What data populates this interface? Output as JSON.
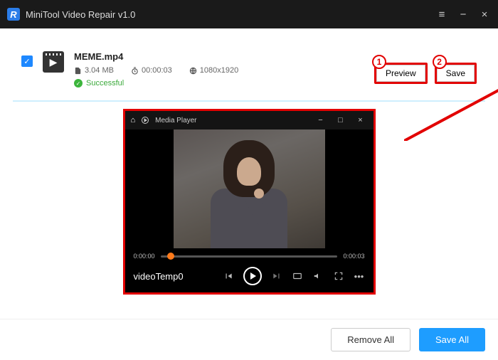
{
  "app": {
    "title": "MiniTool Video Repair v1.0",
    "logo_letter": "R"
  },
  "file": {
    "name": "MEME.mp4",
    "size": "3.04 MB",
    "duration": "00:00:03",
    "resolution": "1080x1920",
    "status": "Successful"
  },
  "actions": {
    "preview": "Preview",
    "save": "Save"
  },
  "callouts": {
    "one": "1",
    "two": "2"
  },
  "player": {
    "app_title": "Media Player",
    "video_title": "videoTemp0",
    "time_current": "0:00:00",
    "time_total": "0:00:03"
  },
  "footer": {
    "remove_all": "Remove All",
    "save_all": "Save All"
  }
}
